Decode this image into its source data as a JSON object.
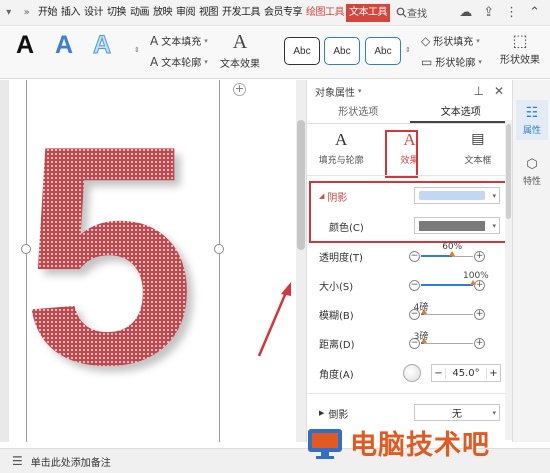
{
  "menubar": {
    "tabs": [
      "开始",
      "插入",
      "设计",
      "切换",
      "动画",
      "放映",
      "审阅",
      "视图",
      "开发工具",
      "会员专享",
      "绘图工具",
      "文本工具"
    ],
    "search_label": "查找"
  },
  "ribbon": {
    "text_fill": "文本填充",
    "text_outline": "文本轮廓",
    "text_effect": "文本效果",
    "style_sample": "Abc",
    "shape_fill": "形状填充",
    "shape_outline": "形状轮廓",
    "shape_effect": "形状效果"
  },
  "document": {
    "big_text": "5"
  },
  "pane": {
    "title": "对象属性",
    "tabs": [
      "形状选项",
      "文本选项"
    ],
    "subtabs": [
      "填充与轮廓",
      "效果",
      "文本框"
    ],
    "shadow_label": "阴影",
    "color_label": "颜色(C)",
    "transparency_label": "透明度(T)",
    "transparency_value": "60%",
    "transparency_fraction": 0.6,
    "size_label": "大小(S)",
    "size_value": "100%",
    "size_fraction": 1.0,
    "blur_label": "模糊(B)",
    "blur_value": "4磅",
    "blur_fraction": 0.05,
    "distance_label": "距离(D)",
    "distance_value": "3磅",
    "distance_fraction": 0.05,
    "angle_label": "角度(A)",
    "angle_value": "45.0°",
    "reflection_label": "倒影",
    "reflection_value": "无"
  },
  "rail": {
    "properties": "属性",
    "features": "特性"
  },
  "status": {
    "notes_placeholder": "单击此处添加备注"
  },
  "watermark": {
    "text": "电脑技术吧"
  },
  "colors": {
    "accent": "#d6453c",
    "highlight": "#d7333a",
    "link": "#2e7fd1",
    "digit_fill": "#b8474a"
  }
}
